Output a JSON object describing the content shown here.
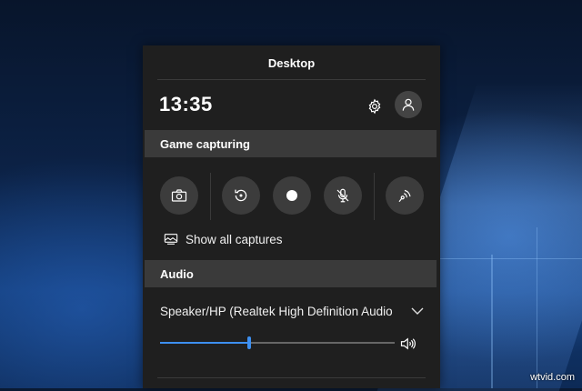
{
  "panel": {
    "title": "Desktop"
  },
  "header": {
    "time": "13:35",
    "settings_icon": "gear-icon",
    "profile_icon": "person-icon"
  },
  "game_capturing": {
    "title": "Game capturing",
    "buttons": [
      {
        "name": "screenshot",
        "icon": "camera-icon"
      },
      {
        "name": "record-last",
        "icon": "rewind-record-icon"
      },
      {
        "name": "start-recording",
        "icon": "record-dot-icon"
      },
      {
        "name": "microphone",
        "icon": "microphone-muted-icon"
      },
      {
        "name": "broadcast",
        "icon": "broadcast-icon"
      }
    ],
    "show_all_label": "Show all captures"
  },
  "audio": {
    "title": "Audio",
    "device": "Speaker/HP (Realtek High Definition Audio",
    "volume_percent": 38,
    "accent": "#3d8ff0"
  },
  "watermark": "wtvid.com"
}
